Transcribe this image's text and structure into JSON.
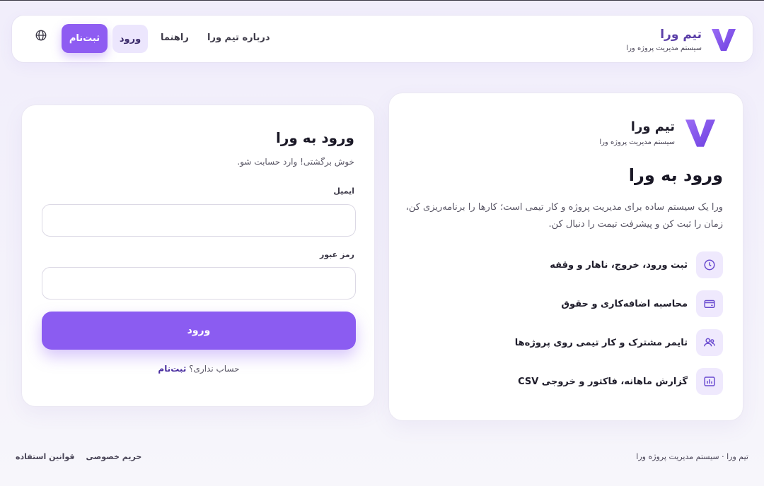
{
  "header": {
    "brand_title": "تیم ورا",
    "brand_subtitle": "سیستم مدیریت پروژه ورا",
    "nav_about": "درباره تیم ورا",
    "nav_guide": "راهنما",
    "nav_login": "ورود",
    "nav_signup": "ثبت‌نام",
    "language_icon": "globe-icon"
  },
  "info": {
    "brand_title": "تیم ورا",
    "brand_subtitle": "سیستم مدیریت پروژه ورا",
    "title": "ورود به ورا",
    "description": "ورا یک سیستم ساده برای مدیریت پروژه و کار تیمی است؛ کارها را برنامه‌ریزی کن، زمان را ثبت کن و پیشرفت تیمت را دنبال کن.",
    "features": [
      {
        "label": "ثبت ورود، خروج، ناهار و وقفه",
        "icon": "clock-icon"
      },
      {
        "label": "محاسبه اضافه‌کاری و حقوق",
        "icon": "wallet-icon"
      },
      {
        "label": "تایمر مشترک و کار تیمی روی پروژه‌ها",
        "icon": "users-icon"
      },
      {
        "label": "گزارش ماهانه، فاکتور و خروجی CSV",
        "icon": "chart-icon"
      }
    ]
  },
  "login": {
    "title": "ورود به ورا",
    "subtitle": "خوش برگشتی! وارد حسابت شو.",
    "email_label": "ایمیل",
    "email_value": "",
    "password_label": "رمز عبور",
    "password_value": "",
    "submit_label": "ورود",
    "no_account_text": "حساب نداری؟",
    "signup_link": "ثبت‌نام"
  },
  "footer": {
    "terms": "قوانین استفاده",
    "privacy": "حریم خصوصی",
    "copyright": "تیم ورا · سیستم مدیریت پروژه ورا"
  },
  "colors": {
    "accent": "#8b5cf1",
    "accent_light": "#efe9fd",
    "background": "#f2effb"
  }
}
